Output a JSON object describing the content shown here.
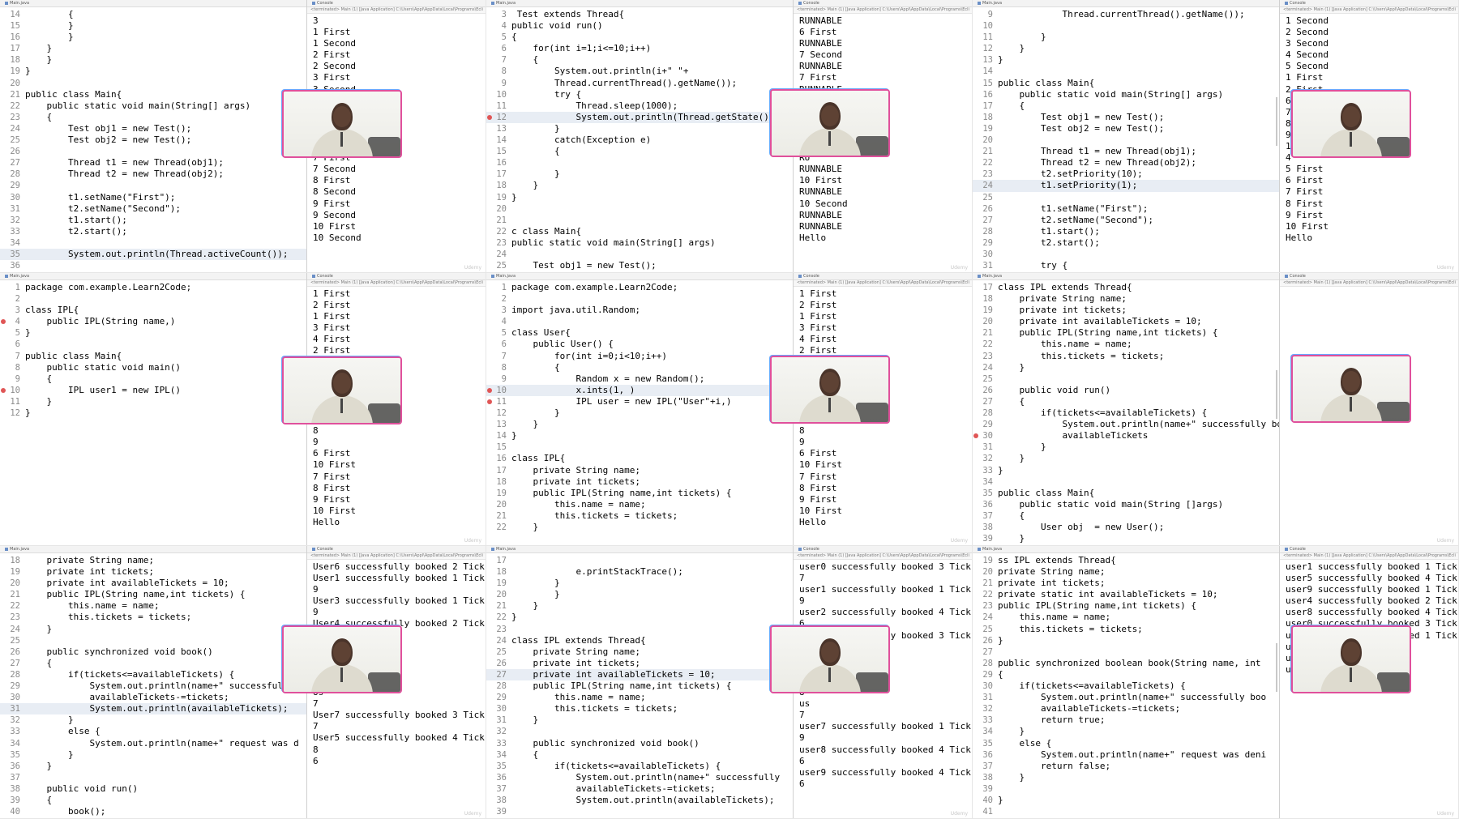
{
  "ui": {
    "editor_tab": "Main.java",
    "console_tab": "Console",
    "console_header": "<terminated> Main (1) [Java Application] C:\\Users\\Appl\\AppData\\Local\\Programs\\Ecli",
    "watermark": "Udemy"
  },
  "tiles": [
    {
      "code": [
        {
          "n": "14",
          "t": "        {"
        },
        {
          "n": "15",
          "t": "        }"
        },
        {
          "n": "16",
          "t": "        }"
        },
        {
          "n": "17",
          "t": "    }"
        },
        {
          "n": "18",
          "t": "    }"
        },
        {
          "n": "19",
          "t": "}"
        },
        {
          "n": "20",
          "t": ""
        },
        {
          "n": "21",
          "t": "public class Main{"
        },
        {
          "n": "22",
          "t": "    public static void main(String[] args)"
        },
        {
          "n": "23",
          "t": "    {"
        },
        {
          "n": "24",
          "t": "        Test obj1 = new Test();"
        },
        {
          "n": "25",
          "t": "        Test obj2 = new Test();"
        },
        {
          "n": "26",
          "t": ""
        },
        {
          "n": "27",
          "t": "        Thread t1 = new Thread(obj1);"
        },
        {
          "n": "28",
          "t": "        Thread t2 = new Thread(obj2);"
        },
        {
          "n": "29",
          "t": ""
        },
        {
          "n": "30",
          "t": "        t1.setName(\"First\");"
        },
        {
          "n": "31",
          "t": "        t2.setName(\"Second\");"
        },
        {
          "n": "32",
          "t": "        t1.start();"
        },
        {
          "n": "33",
          "t": "        t2.start();"
        },
        {
          "n": "34",
          "t": ""
        },
        {
          "n": "35",
          "t": "        System.out.println(Thread.activeCount());"
        },
        {
          "n": "36",
          "t": ""
        }
      ],
      "console": [
        "3",
        "1 First",
        "1 Second",
        "2 First",
        "2 Second",
        "3 First",
        "3 Second",
        "4",
        "5",
        "5",
        "6",
        "6",
        "7 First",
        "7 Second",
        "8 First",
        "8 Second",
        "9 First",
        "9 Second",
        "10 First",
        "10 Second"
      ]
    },
    {
      "code": [
        {
          "n": "3",
          "t": " Test extends Thread{"
        },
        {
          "n": "4",
          "t": "public void run()"
        },
        {
          "n": "5",
          "t": "{"
        },
        {
          "n": "6",
          "t": "    for(int i=1;i<=10;i++)"
        },
        {
          "n": "7",
          "t": "    {"
        },
        {
          "n": "8",
          "t": "        System.out.println(i+\" \"+"
        },
        {
          "n": "9",
          "t": "        Thread.currentThread().getName());"
        },
        {
          "n": "10",
          "t": "        try {"
        },
        {
          "n": "11",
          "t": "            Thread.sleep(1000);"
        },
        {
          "n": "12",
          "t": "            System.out.println(Thread.getState());"
        },
        {
          "n": "13",
          "t": "        }"
        },
        {
          "n": "14",
          "t": "        catch(Exception e)"
        },
        {
          "n": "15",
          "t": "        {"
        },
        {
          "n": "16",
          "t": ""
        },
        {
          "n": "17",
          "t": "        }"
        },
        {
          "n": "18",
          "t": "    }"
        },
        {
          "n": "19",
          "t": "}"
        },
        {
          "n": "20",
          "t": ""
        },
        {
          "n": "21",
          "t": ""
        },
        {
          "n": "22",
          "t": "c class Main{"
        },
        {
          "n": "23",
          "t": "public static void main(String[] args)"
        },
        {
          "n": "24",
          "t": ""
        },
        {
          "n": "25",
          "t": "    Test obj1 = new Test();"
        }
      ],
      "console": [
        "RUNNABLE",
        "6 First",
        "RUNNABLE",
        "7 Second",
        "RUNNABLE",
        "7 First",
        "RUNNABLE",
        "8",
        "RU",
        "8",
        "RU",
        "9",
        "RU",
        "RUNNABLE",
        "10 First",
        "RUNNABLE",
        "10 Second",
        "RUNNABLE",
        "RUNNABLE",
        "Hello"
      ]
    },
    {
      "code": [
        {
          "n": "9",
          "t": "            Thread.currentThread().getName());"
        },
        {
          "n": "10",
          "t": ""
        },
        {
          "n": "11",
          "t": "        }"
        },
        {
          "n": "12",
          "t": "    }"
        },
        {
          "n": "13",
          "t": "}"
        },
        {
          "n": "14",
          "t": ""
        },
        {
          "n": "15",
          "t": "public class Main{"
        },
        {
          "n": "16",
          "t": "    public static void main(String[] args)"
        },
        {
          "n": "17",
          "t": "    {"
        },
        {
          "n": "18",
          "t": "        Test obj1 = new Test();"
        },
        {
          "n": "19",
          "t": "        Test obj2 = new Test();"
        },
        {
          "n": "20",
          "t": ""
        },
        {
          "n": "21",
          "t": "        Thread t1 = new Thread(obj1);"
        },
        {
          "n": "22",
          "t": "        Thread t2 = new Thread(obj2);"
        },
        {
          "n": "23",
          "t": "        t2.setPriority(10);"
        },
        {
          "n": "24",
          "t": "        t1.setPriority(1);"
        },
        {
          "n": "25",
          "t": ""
        },
        {
          "n": "26",
          "t": "        t1.setName(\"First\");"
        },
        {
          "n": "27",
          "t": "        t2.setName(\"Second\");"
        },
        {
          "n": "28",
          "t": "        t1.start();"
        },
        {
          "n": "29",
          "t": "        t2.start();"
        },
        {
          "n": "30",
          "t": ""
        },
        {
          "n": "31",
          "t": "        try {"
        }
      ],
      "console": [
        "1 Second",
        "2 Second",
        "3 Second",
        "4 Second",
        "5 Second",
        "1 First",
        "2 First",
        "6",
        "7",
        "8",
        "9",
        "10",
        "4",
        "5 First",
        "6 First",
        "7 First",
        "8 First",
        "9 First",
        "10 First",
        "Hello"
      ]
    },
    {
      "code": [
        {
          "n": "1",
          "t": "package com.example.Learn2Code;"
        },
        {
          "n": "2",
          "t": ""
        },
        {
          "n": "3",
          "t": "class IPL{"
        },
        {
          "n": "4",
          "t": "    public IPL(String name,)"
        },
        {
          "n": "5",
          "t": "}"
        },
        {
          "n": "6",
          "t": ""
        },
        {
          "n": "7",
          "t": "public class Main{"
        },
        {
          "n": "8",
          "t": "    public static void main()"
        },
        {
          "n": "9",
          "t": "    {"
        },
        {
          "n": "10",
          "t": "        IPL user1 = new IPL()"
        },
        {
          "n": "11",
          "t": "    }"
        },
        {
          "n": "12",
          "t": "}"
        }
      ],
      "console": [
        "1 First",
        "2 First",
        "1 First",
        "3 First",
        "4 First",
        "2 First",
        "5 First",
        "3",
        "4",
        "5",
        "6",
        "7",
        "8",
        "9",
        "6 First",
        "10 First",
        "7 First",
        "8 First",
        "9 First",
        "10 First",
        "Hello"
      ]
    },
    {
      "code": [
        {
          "n": "1",
          "t": "package com.example.Learn2Code;"
        },
        {
          "n": "2",
          "t": ""
        },
        {
          "n": "3",
          "t": "import java.util.Random;"
        },
        {
          "n": "4",
          "t": ""
        },
        {
          "n": "5",
          "t": "class User{"
        },
        {
          "n": "6",
          "t": "    public User() {"
        },
        {
          "n": "7",
          "t": "        for(int i=0;i<10;i++)"
        },
        {
          "n": "8",
          "t": "        {"
        },
        {
          "n": "9",
          "t": "            Random x = new Random();"
        },
        {
          "n": "10",
          "t": "            x.ints(1, )"
        },
        {
          "n": "11",
          "t": "            IPL user = new IPL(\"User\"+i,)"
        },
        {
          "n": "12",
          "t": "        }"
        },
        {
          "n": "13",
          "t": "    }"
        },
        {
          "n": "14",
          "t": "}"
        },
        {
          "n": "15",
          "t": ""
        },
        {
          "n": "16",
          "t": "class IPL{"
        },
        {
          "n": "17",
          "t": "    private String name;"
        },
        {
          "n": "18",
          "t": "    private int tickets;"
        },
        {
          "n": "19",
          "t": "    public IPL(String name,int tickets) {"
        },
        {
          "n": "20",
          "t": "        this.name = name;"
        },
        {
          "n": "21",
          "t": "        this.tickets = tickets;"
        },
        {
          "n": "22",
          "t": "    }"
        }
      ],
      "console": [
        "1 First",
        "2 First",
        "1 First",
        "3 First",
        "4 First",
        "2 First",
        "5 First",
        "3",
        "4",
        "5",
        "6",
        "7",
        "8",
        "9",
        "6 First",
        "10 First",
        "7 First",
        "8 First",
        "9 First",
        "10 First",
        "Hello"
      ]
    },
    {
      "code": [
        {
          "n": "17",
          "t": "class IPL extends Thread{"
        },
        {
          "n": "18",
          "t": "    private String name;"
        },
        {
          "n": "19",
          "t": "    private int tickets;"
        },
        {
          "n": "20",
          "t": "    private int availableTickets = 10;"
        },
        {
          "n": "21",
          "t": "    public IPL(String name,int tickets) {"
        },
        {
          "n": "22",
          "t": "        this.name = name;"
        },
        {
          "n": "23",
          "t": "        this.tickets = tickets;"
        },
        {
          "n": "24",
          "t": "    }"
        },
        {
          "n": "25",
          "t": ""
        },
        {
          "n": "26",
          "t": "    public void run()"
        },
        {
          "n": "27",
          "t": "    {"
        },
        {
          "n": "28",
          "t": "        if(tickets<=availableTickets) {"
        },
        {
          "n": "29",
          "t": "            System.out.println(name+\" successfully booked"
        },
        {
          "n": "30",
          "t": "            availableTickets"
        },
        {
          "n": "31",
          "t": "        }"
        },
        {
          "n": "32",
          "t": "    }"
        },
        {
          "n": "33",
          "t": "}"
        },
        {
          "n": "34",
          "t": ""
        },
        {
          "n": "35",
          "t": "public class Main{"
        },
        {
          "n": "36",
          "t": "    public static void main(String []args)"
        },
        {
          "n": "37",
          "t": "    {"
        },
        {
          "n": "38",
          "t": "        User obj  = new User();"
        },
        {
          "n": "39",
          "t": "    }"
        }
      ],
      "console": []
    },
    {
      "code": [
        {
          "n": "18",
          "t": "    private String name;"
        },
        {
          "n": "19",
          "t": "    private int tickets;"
        },
        {
          "n": "20",
          "t": "    private int availableTickets = 10;"
        },
        {
          "n": "21",
          "t": "    public IPL(String name,int tickets) {"
        },
        {
          "n": "22",
          "t": "        this.name = name;"
        },
        {
          "n": "23",
          "t": "        this.tickets = tickets;"
        },
        {
          "n": "24",
          "t": "    }"
        },
        {
          "n": "25",
          "t": ""
        },
        {
          "n": "26",
          "t": "    public synchronized void book()"
        },
        {
          "n": "27",
          "t": "    {"
        },
        {
          "n": "28",
          "t": "        if(tickets<=availableTickets) {"
        },
        {
          "n": "29",
          "t": "            System.out.println(name+\" successfully"
        },
        {
          "n": "30",
          "t": "            availableTickets-=tickets;"
        },
        {
          "n": "31",
          "t": "            System.out.println(availableTickets);"
        },
        {
          "n": "32",
          "t": "        }"
        },
        {
          "n": "33",
          "t": "        else {"
        },
        {
          "n": "34",
          "t": "            System.out.println(name+\" request was d"
        },
        {
          "n": "35",
          "t": "        }"
        },
        {
          "n": "36",
          "t": "    }"
        },
        {
          "n": "37",
          "t": ""
        },
        {
          "n": "38",
          "t": "    public void run()"
        },
        {
          "n": "39",
          "t": "    {"
        },
        {
          "n": "40",
          "t": "        book();"
        }
      ],
      "console": [
        "User6 successfully booked 2 Tick",
        "User1 successfully booked 1 Tick",
        "9",
        "User3 successfully booked 1 Tick",
        "9",
        "User4 successfully booked 2 Tick",
        "8",
        "Us",
        "7",
        "Us",
        "7",
        "Us",
        "7",
        "User7 successfully booked 3 Tick",
        "7",
        "User5 successfully booked 4 Tick",
        "8",
        "6"
      ]
    },
    {
      "code": [
        {
          "n": "17",
          "t": ""
        },
        {
          "n": "18",
          "t": "            e.printStackTrace();"
        },
        {
          "n": "19",
          "t": "        }"
        },
        {
          "n": "20",
          "t": "        }"
        },
        {
          "n": "21",
          "t": "    }"
        },
        {
          "n": "22",
          "t": "}"
        },
        {
          "n": "23",
          "t": ""
        },
        {
          "n": "24",
          "t": "class IPL extends Thread{"
        },
        {
          "n": "25",
          "t": "    private String name;"
        },
        {
          "n": "26",
          "t": "    private int tickets;"
        },
        {
          "n": "27",
          "t": "    private int availableTickets = 10;"
        },
        {
          "n": "28",
          "t": "    public IPL(String name,int tickets) {"
        },
        {
          "n": "29",
          "t": "        this.name = name;"
        },
        {
          "n": "30",
          "t": "        this.tickets = tickets;"
        },
        {
          "n": "31",
          "t": "    }"
        },
        {
          "n": "32",
          "t": ""
        },
        {
          "n": "33",
          "t": "    public synchronized void book()"
        },
        {
          "n": "34",
          "t": "    {"
        },
        {
          "n": "35",
          "t": "        if(tickets<=availableTickets) {"
        },
        {
          "n": "36",
          "t": "            System.out.println(name+\" successfully"
        },
        {
          "n": "37",
          "t": "            availableTickets-=tickets;"
        },
        {
          "n": "38",
          "t": "            System.out.println(availableTickets);"
        },
        {
          "n": "39",
          "t": ""
        }
      ],
      "console": [
        "user0 successfully booked 3 Tick",
        "7",
        "user1 successfully booked 1 Tick",
        "9",
        "user2 successfully booked 4 Tick",
        "6",
        "user3 successfully booked 3 Tick",
        "7",
        "us",
        "8",
        "us",
        "8",
        "us",
        "7",
        "user7 successfully booked 1 Tick",
        "9",
        "user8 successfully booked 4 Tick",
        "6",
        "user9 successfully booked 4 Tick",
        "6"
      ]
    },
    {
      "code": [
        {
          "n": "19",
          "t": "ss IPL extends Thread{"
        },
        {
          "n": "20",
          "t": "private String name;"
        },
        {
          "n": "21",
          "t": "private int tickets;"
        },
        {
          "n": "22",
          "t": "private static int availableTickets = 10;"
        },
        {
          "n": "23",
          "t": "public IPL(String name,int tickets) {"
        },
        {
          "n": "24",
          "t": "    this.name = name;"
        },
        {
          "n": "25",
          "t": "    this.tickets = tickets;"
        },
        {
          "n": "26",
          "t": "}"
        },
        {
          "n": "27",
          "t": ""
        },
        {
          "n": "28",
          "t": "public synchronized boolean book(String name, int"
        },
        {
          "n": "29",
          "t": "{"
        },
        {
          "n": "30",
          "t": "    if(tickets<=availableTickets) {"
        },
        {
          "n": "31",
          "t": "        System.out.println(name+\" successfully boo"
        },
        {
          "n": "32",
          "t": "        availableTickets-=tickets;"
        },
        {
          "n": "33",
          "t": "        return true;"
        },
        {
          "n": "34",
          "t": "    }"
        },
        {
          "n": "35",
          "t": "    else {"
        },
        {
          "n": "36",
          "t": "        System.out.println(name+\" request was deni"
        },
        {
          "n": "37",
          "t": "        return false;"
        },
        {
          "n": "38",
          "t": "    }"
        },
        {
          "n": "39",
          "t": ""
        },
        {
          "n": "40",
          "t": "}"
        },
        {
          "n": "41",
          "t": ""
        }
      ],
      "console": [
        "user1 successfully booked 1 Tick",
        "user5 successfully booked 4 Tick",
        "user9 successfully booked 1 Tick",
        "user4 successfully booked 2 Tick",
        "user8 successfully booked 4 Tick",
        "user0 successfully booked 3 Tick",
        "user2 successfully booked 1 Tick",
        "us",
        "us",
        "us"
      ]
    }
  ]
}
